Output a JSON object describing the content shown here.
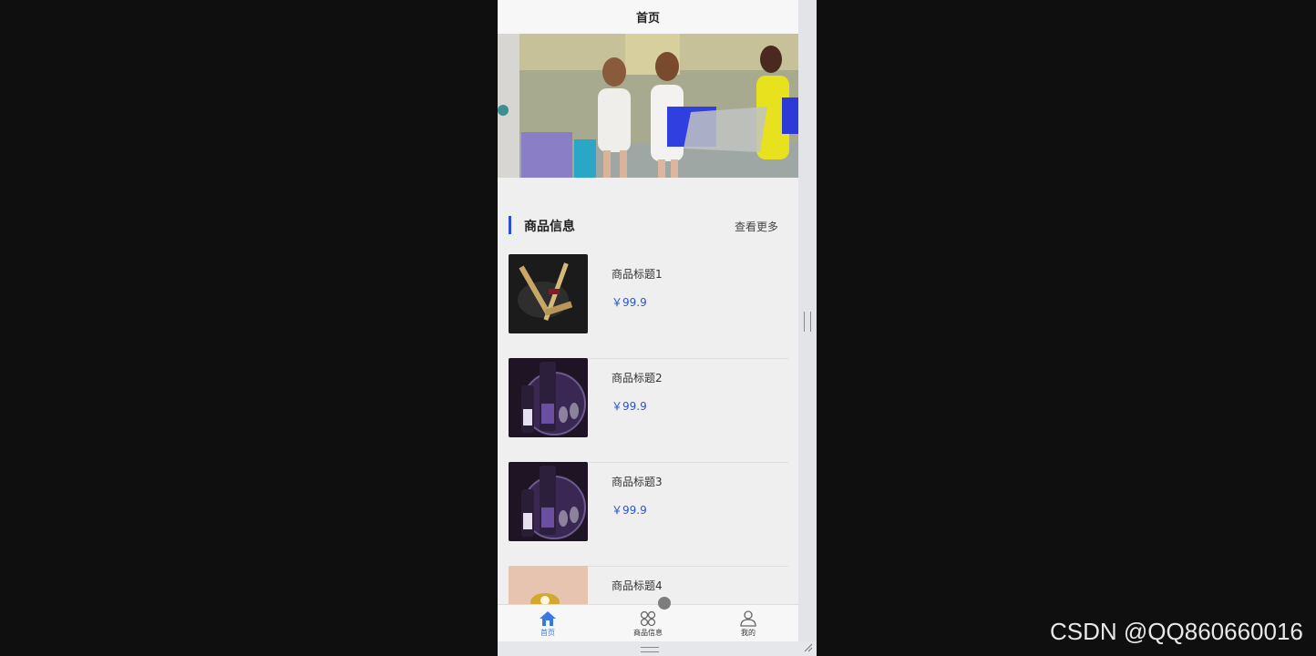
{
  "header": {
    "title": "首页"
  },
  "section": {
    "title": "商品信息",
    "more_label": "查看更多"
  },
  "products": [
    {
      "title": "商品标题1",
      "price": "￥99.9",
      "image": "ysl-lipstick-photo"
    },
    {
      "title": "商品标题2",
      "price": "￥99.9",
      "image": "purple-cosmetics-photo"
    },
    {
      "title": "商品标题3",
      "price": "￥99.9",
      "image": "purple-cosmetics-photo"
    },
    {
      "title": "商品标题4",
      "price": "",
      "image": "gold-jewelry-photo"
    }
  ],
  "tabbar": {
    "items": [
      {
        "label": "首页",
        "icon": "home-icon",
        "active": true
      },
      {
        "label": "商品信息",
        "icon": "grid-icon",
        "active": false
      },
      {
        "label": "我的",
        "icon": "user-icon",
        "active": false
      }
    ]
  },
  "colors": {
    "accent": "#2c4ed4",
    "price": "#2a56c9",
    "tab_active": "#3a78e6"
  },
  "watermark": "CSDN @QQ860660016"
}
